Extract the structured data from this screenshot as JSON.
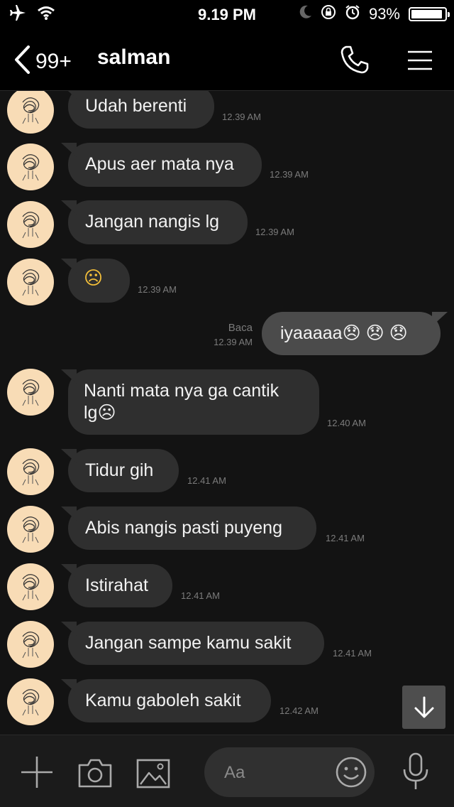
{
  "status": {
    "time": "9.19 PM",
    "battery": "93%",
    "battery_level": 0.93
  },
  "header": {
    "back_count": "99+",
    "contact_name": "salman"
  },
  "messages": [
    {
      "text": "Udah berenti",
      "time": "12.39 AM"
    },
    {
      "text": "Apus aer mata nya",
      "time": "12.39 AM"
    },
    {
      "text": "Jangan nangis lg",
      "time": "12.39 AM"
    },
    {
      "text": "☹",
      "time": "12.39 AM"
    },
    {
      "text": "iyaaaaa😞 😞 😞",
      "time": "12.39 AM",
      "status": "Baca"
    },
    {
      "line1": "Nanti mata nya ga cantik",
      "line2": "lg☹",
      "time": "12.40 AM"
    },
    {
      "text": "Tidur gih",
      "time": "12.41 AM"
    },
    {
      "text": "Abis nangis pasti puyeng",
      "time": "12.41 AM"
    },
    {
      "text": "Istirahat",
      "time": "12.41 AM"
    },
    {
      "text": "Jangan sampe kamu sakit",
      "time": "12.41 AM"
    },
    {
      "text": "Kamu gaboleh sakit",
      "time": "12.42 AM"
    }
  ],
  "input": {
    "placeholder": "Aa"
  }
}
